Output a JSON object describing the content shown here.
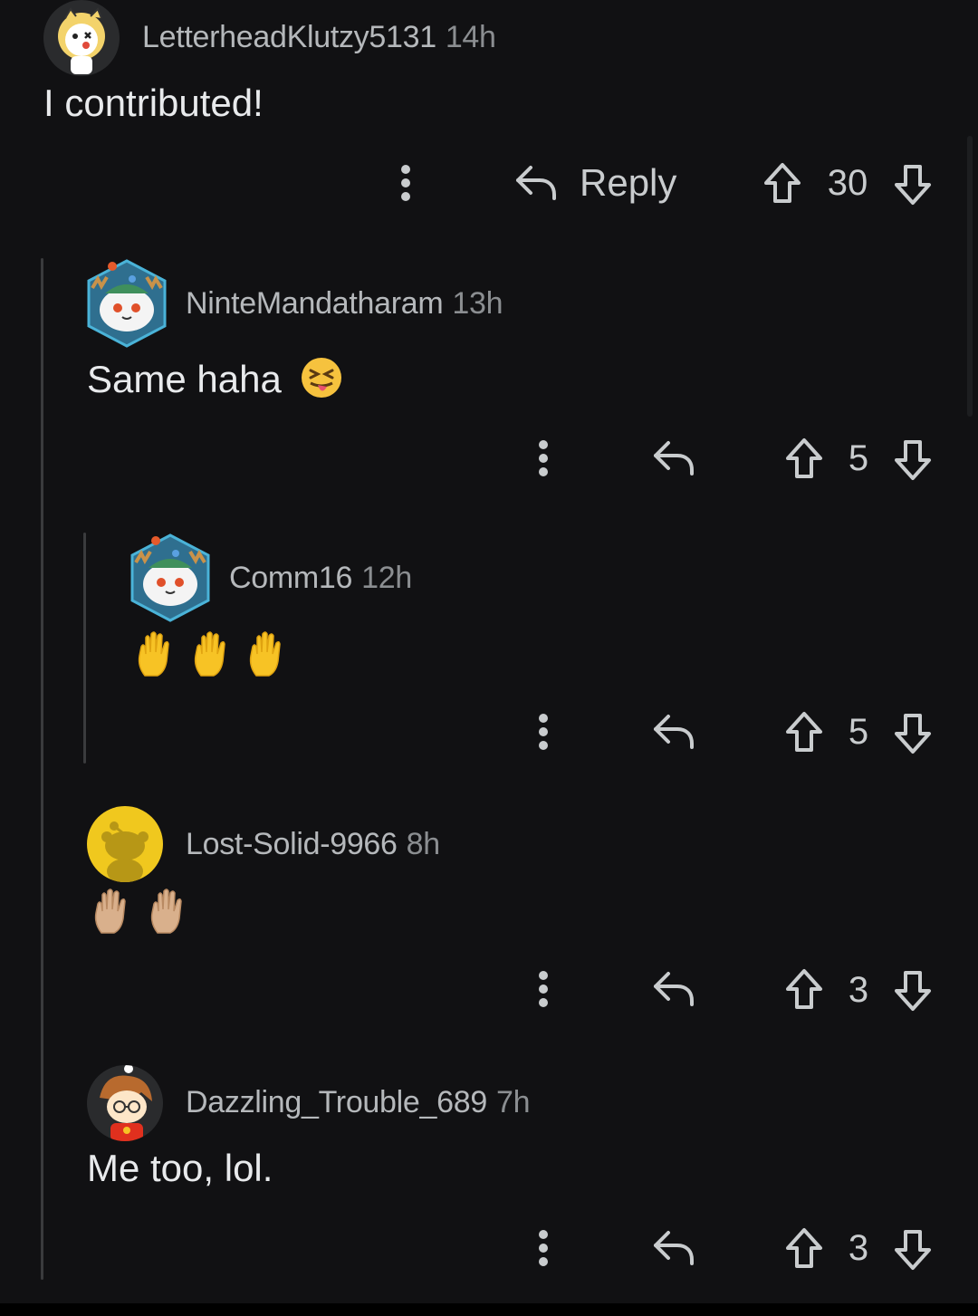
{
  "comments": [
    {
      "username": "LetterheadKlutzy5131",
      "time": "14h",
      "body": "I contributed!",
      "reply_label": "Reply",
      "votes": "30",
      "avatar": "snoo-tiger-avatar",
      "depth": 0
    },
    {
      "username": "NinteMandatharam",
      "time": "13h",
      "body": "Same haha",
      "body_emoji": "squinting-tongue-emoji",
      "votes": "5",
      "avatar": "white-cat-antlers-avatar",
      "depth": 1
    },
    {
      "username": "Comm16",
      "time": "12h",
      "body": "",
      "body_emoji": "raised-hand-emoji x3",
      "votes": "5",
      "avatar": "white-cat-antlers-avatar",
      "depth": 2
    },
    {
      "username": "Lost-Solid-9966",
      "time": "8h",
      "body": "",
      "body_emoji": "raised-hand-medium-light-emoji x2",
      "votes": "3",
      "avatar": "yellow-snoo-avatar",
      "depth": 1
    },
    {
      "username": "Dazzling_Trouble_689",
      "time": "7h",
      "body": "Me too, lol.",
      "votes": "3",
      "avatar": "snoo-glasses-avatar",
      "depth": 1
    }
  ],
  "colors": {
    "background": "#111113",
    "thread_line": "#3a3b3d",
    "text": "#e8eaec",
    "muted": "#8b8e91"
  }
}
